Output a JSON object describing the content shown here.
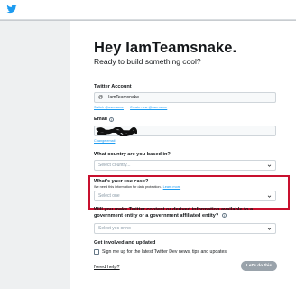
{
  "header": {
    "logo_icon": "twitter-bird-icon",
    "brand_color": "#1d9bf0"
  },
  "form": {
    "title": "Hey IamTeamsnake.",
    "subtitle": "Ready to build something cool?",
    "account": {
      "label": "Twitter Account",
      "at": "@",
      "value": "IamTeamsnake",
      "switch_link": "Switch @username",
      "create_link": "Create new @username"
    },
    "email": {
      "label": "Email",
      "change_link": "Change email"
    },
    "country": {
      "label": "What country are you based in?",
      "placeholder": "Select country..."
    },
    "use_case": {
      "label": "What's your use case?",
      "helper": "We need this information for data protection.",
      "learn_more": "Learn more",
      "placeholder": "Select one",
      "highlight_color": "#c8102e"
    },
    "government": {
      "label": "Will you make Twitter content or derived information available to a government entity or a government affiliated entity?",
      "placeholder": "Select yes or no"
    },
    "updates": {
      "label": "Get involved and updated",
      "checkbox_label": "Sign me up for the latest Twitter Dev news, tips and updates"
    },
    "need_help": "Need help?",
    "submit": "Let's do this"
  }
}
